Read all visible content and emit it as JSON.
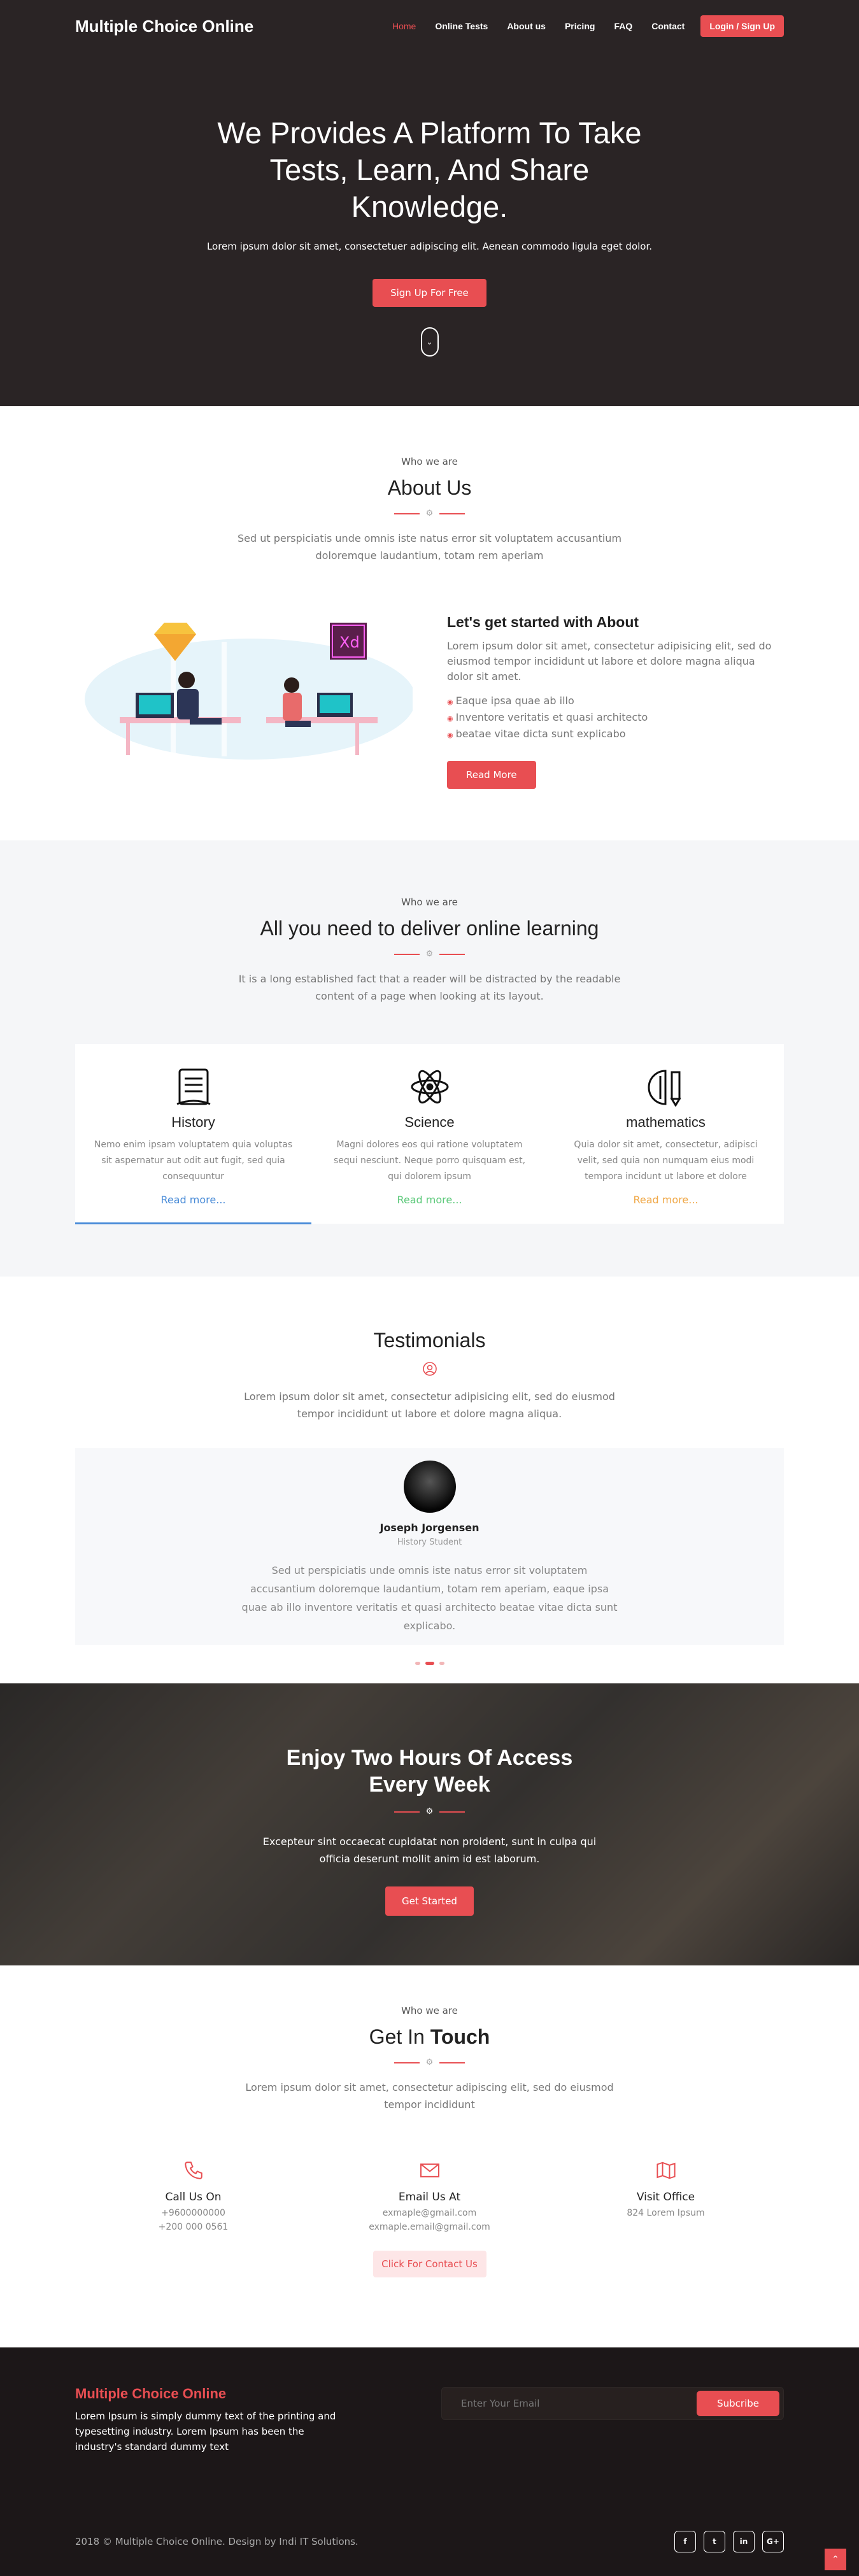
{
  "nav": {
    "brand": "Multiple Choice Online",
    "items": [
      "Home",
      "Online Tests",
      "About us",
      "Pricing",
      "FAQ",
      "Contact"
    ],
    "login": "Login / Sign Up"
  },
  "hero": {
    "title": "We Provides A Platform To Take Tests, Learn, And Share Knowledge.",
    "subtitle": "Lorem ipsum dolor sit amet, consectetuer adipiscing elit. Aenean commodo ligula eget dolor.",
    "cta": "Sign Up For Free"
  },
  "about": {
    "eyebrow": "Who we are",
    "title": "About Us",
    "desc": "Sed ut perspiciatis unde omnis iste natus error sit voluptatem accusantium doloremque laudantium, totam rem aperiam",
    "illus_badge": "Xd",
    "heading": "Let's get started with About",
    "text": "Lorem ipsum dolor sit amet, consectetur adipisicing elit, sed do eiusmod tempor incididunt ut labore et dolore magna aliqua dolor sit amet.",
    "bullets": [
      "Eaque ipsa quae ab illo",
      "Inventore veritatis et quasi architecto",
      "beatae vitae dicta sunt explicabo"
    ],
    "button": "Read More"
  },
  "learning": {
    "eyebrow": "Who we are",
    "title": "All you need to deliver online learning",
    "desc": "It is a long established fact that a reader will be distracted by the readable content of a page when looking at its layout.",
    "cards": [
      {
        "title": "History",
        "text": "Nemo enim ipsam voluptatem quia voluptas sit aspernatur aut odit aut fugit, sed quia consequuntur",
        "link": "Read more...",
        "color": "#4a8cd8"
      },
      {
        "title": "Science",
        "text": "Magni dolores eos qui ratione voluptatem sequi nesciunt. Neque porro quisquam est, qui dolorem ipsum",
        "link": "Read more...",
        "color": "#5cc97a"
      },
      {
        "title": "mathematics",
        "text": "Quia dolor sit amet, consectetur, adipisci velit, sed quia non numquam eius modi tempora incidunt ut labore et dolore",
        "link": "Read more...",
        "color": "#f0a848"
      }
    ]
  },
  "testimonials": {
    "title": "Testimonials",
    "desc": "Lorem ipsum dolor sit amet, consectetur adipisicing elit, sed do eiusmod tempor incididunt ut labore et dolore magna aliqua.",
    "name": "Joseph Jorgensen",
    "role": "History Student",
    "quote": "Sed ut perspiciatis unde omnis iste natus error sit voluptatem accusantium doloremque laudantium, totam rem aperiam, eaque ipsa quae ab illo inventore veritatis et quasi architecto beatae vitae dicta sunt explicabo."
  },
  "cta": {
    "title": "Enjoy Two Hours Of Access Every Week",
    "text": "Excepteur sint occaecat cupidatat non proident, sunt in culpa qui officia deserunt mollit anim id est laborum.",
    "button": "Get Started"
  },
  "contact": {
    "eyebrow": "Who we are",
    "title_a": "Get In",
    "title_b": "Touch",
    "desc": "Lorem ipsum dolor sit amet, consectetur adipiscing elit, sed do eiusmod tempor incididunt",
    "call": {
      "title": "Call Us On",
      "l1": "+9600000000",
      "l2": "+200 000 0561"
    },
    "email": {
      "title": "Email Us At",
      "l1": "exmaple@gmail.com",
      "l2": "exmaple.email@gmail.com"
    },
    "office": {
      "title": "Visit Office",
      "l1": "824 Lorem Ipsum"
    },
    "button": "Click For Contact Us"
  },
  "footer": {
    "brand": "Multiple Choice Online",
    "text": "Lorem Ipsum is simply dummy text of the printing and typesetting industry. Lorem Ipsum has been the industry's standard dummy text",
    "placeholder": "Enter Your Email",
    "subscribe": "Subcribe",
    "copyright": "2018 © Multiple Choice Online. Design by Indi IT Solutions.",
    "social": [
      "f",
      "t",
      "in",
      "G+"
    ]
  },
  "colors": {
    "accent": "#e84e52",
    "hero_bg": "#2a2425",
    "footer_bg": "#1c1718"
  }
}
